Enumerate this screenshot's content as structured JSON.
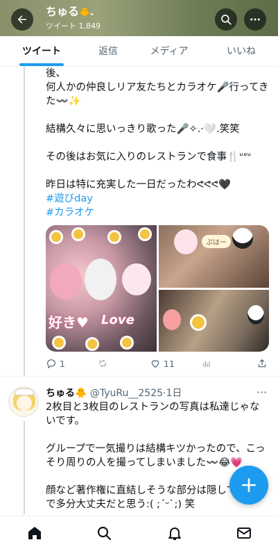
{
  "header": {
    "name": "ちゅる",
    "name_emoji": "🐥",
    "name_suffix": "ₒ",
    "tweet_count": "ツイート 1,849"
  },
  "tabs": [
    {
      "label": "ツイート",
      "active": true
    },
    {
      "label": "返信",
      "active": false
    },
    {
      "label": "メディア",
      "active": false
    },
    {
      "label": "いいね",
      "active": false
    }
  ],
  "tweet1": {
    "line1": "後、",
    "line2": "何人かの仲良しリア友たちとカラオケ🎤行ってきた〰️✨",
    "line3": "結構久々に思いっきり歌った🎤✧.·🤍.笑笑",
    "line4": "その後はお気に入りのレストランで食事🍴ᐡᐤᐡ",
    "line5": "昨日は特に充実した一日だったわᕙᕙᕙ🖤",
    "hashtag1": "#遊びday",
    "hashtag2": "#カラオケ",
    "photo_text_1": "好き♥",
    "photo_text_2": "Love",
    "photo_bubble": "ぷはー",
    "replies": "1",
    "likes": "11"
  },
  "tweet2": {
    "name": "ちゅる",
    "emoji": "🐥",
    "handle": "@TyuRu__2525",
    "time": "·1日",
    "para1": "2枚目と3枚目のレストランの写真は私達じゃないです。",
    "para2": "グループで一気撮りは結構キツかったので、こっそり周りの人を撮ってしまいました〰️😂💗",
    "para3": "顔など著作権に直結しそうな部分は隠してるので多分大丈夫だと思う:( ;´ᵕ`;) 笑"
  },
  "colors": {
    "accent": "#1d9bf0",
    "text": "#0f1419",
    "muted": "#536471"
  },
  "icons": {
    "back": "arrow-left-icon",
    "search": "search-icon",
    "more": "more-icon",
    "home": "home-icon",
    "explore": "search-icon",
    "notifications": "bell-icon",
    "messages": "mail-icon",
    "compose": "plus-icon"
  }
}
